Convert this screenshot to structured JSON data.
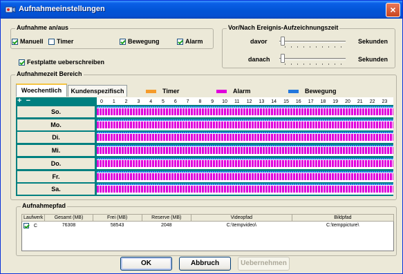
{
  "window": {
    "title": "Aufnahmeeinstellungen",
    "close_glyph": "×",
    "icon": "record-camera-icon"
  },
  "aufnahme": {
    "group_title": "Aufnahme an/aus",
    "manuell": {
      "label": "Manuell",
      "checked": true
    },
    "timer": {
      "label": "Timer",
      "checked": false
    },
    "bewegung": {
      "label": "Bewegung",
      "checked": true
    },
    "alarm": {
      "label": "Alarm",
      "checked": true
    },
    "festplatte": {
      "label": "Festplatte ueberschreiben",
      "checked": true
    }
  },
  "vornach": {
    "group_title": "Vor/Nach Ereignis-Aufzeichnungszeit",
    "davor_label": "davor",
    "danach_label": "danach",
    "unit": "Sekunden",
    "davor_value": 0,
    "danach_value": 0
  },
  "zeitbereich": {
    "group_title": "Aufnahmezeit Bereich",
    "tabs": [
      "Woechentlich",
      "Kundenspezifisch"
    ],
    "active_tab": 0,
    "legend": [
      {
        "label": "Timer",
        "color": "#f59b2b"
      },
      {
        "label": "Alarm",
        "color": "#e000dc"
      },
      {
        "label": "Bewegung",
        "color": "#2277dd"
      }
    ],
    "plus": "+",
    "minus": "−",
    "hours": [
      "0",
      "1",
      "2",
      "3",
      "4",
      "5",
      "6",
      "7",
      "8",
      "9",
      "10",
      "11",
      "12",
      "13",
      "14",
      "15",
      "16",
      "17",
      "18",
      "19",
      "20",
      "21",
      "22",
      "23"
    ],
    "days": [
      "So.",
      "Mo.",
      "Di.",
      "Mi.",
      "Do.",
      "Fr.",
      "Sa."
    ]
  },
  "pfad": {
    "group_title": "Aufnahmepfad",
    "columns": [
      "Laufwerk",
      "Gesamt (MB)",
      "Frei (MB)",
      "Reserve (MB)",
      "Videopfad",
      "Bildpfad"
    ],
    "rows": [
      {
        "checked": true,
        "laufwerk": "C",
        "gesamt": "76308",
        "frei": "58543",
        "reserve": "2048",
        "videopfad": "C:\\tempvideo\\",
        "bildpfad": "C:\\temppicture\\"
      }
    ]
  },
  "buttons": {
    "ok": "OK",
    "abbruch": "Abbruch",
    "uebernehmen": "Uebernehmen"
  },
  "colors": {
    "grid_bg": "#008080",
    "alarm": "#e000dc",
    "bewegung": "#2277dd",
    "timer": "#f59b2b"
  }
}
